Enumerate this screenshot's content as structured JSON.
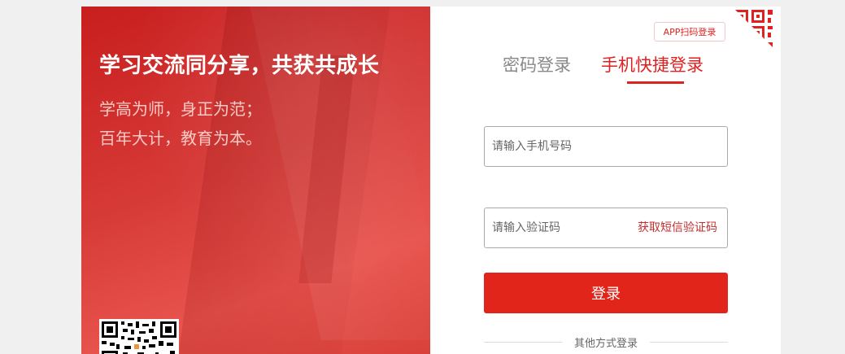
{
  "promo": {
    "headline": "学习交流同分享，共获共成长",
    "subline1": "学高为师，身正为范；",
    "subline2": "百年大计，教育为本。"
  },
  "login": {
    "app_scan_label": "APP扫码登录",
    "tabs": [
      {
        "label": "密码登录",
        "active": false
      },
      {
        "label": "手机快捷登录",
        "active": true
      }
    ],
    "phone_placeholder": "请输入手机号码",
    "code_placeholder": "请输入验证码",
    "get_code_label": "获取短信验证码",
    "submit_label": "登录",
    "other_methods_label": "其他方式登录"
  },
  "colors": {
    "accent": "#e1251b",
    "promo_bg": "#d63a37",
    "page_bg": "#f0f0f0"
  }
}
